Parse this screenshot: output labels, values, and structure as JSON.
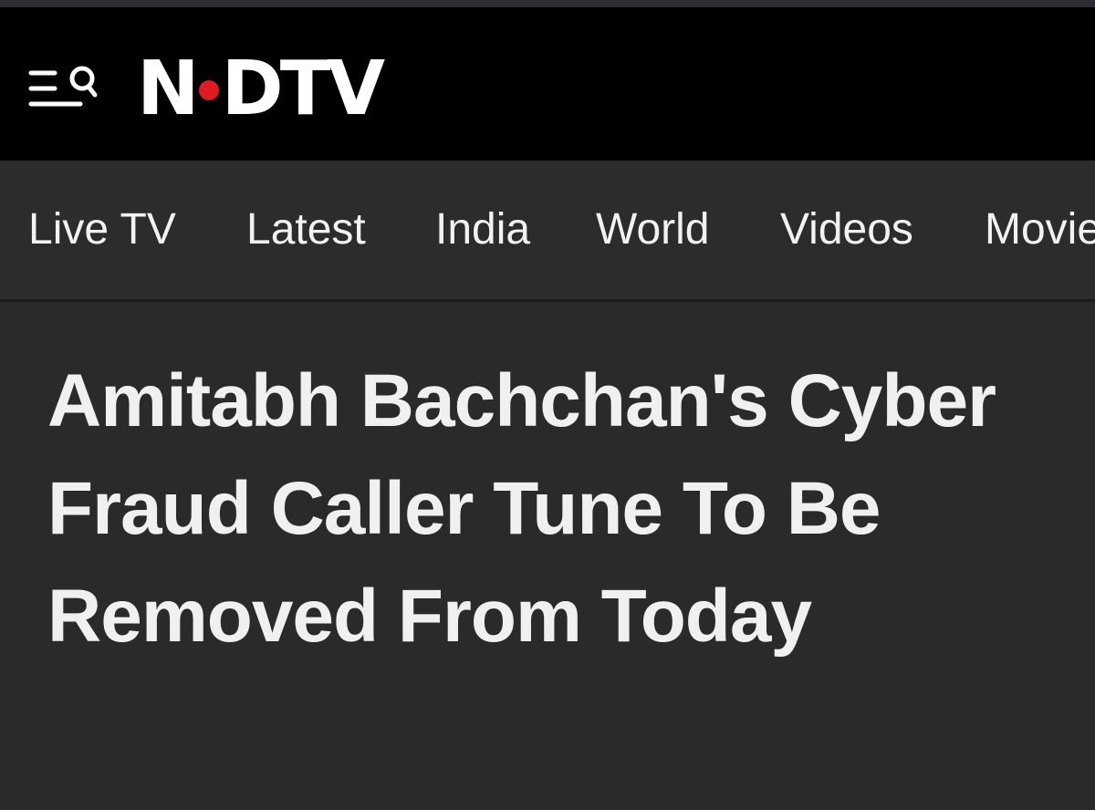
{
  "header": {
    "menu_icon": "hamburger-search-icon",
    "logo_text_left": "N",
    "logo_text_right": "DTV",
    "logo_dot_color": "#e01b22"
  },
  "nav": {
    "items": [
      {
        "label": "Live TV"
      },
      {
        "label": "Latest"
      },
      {
        "label": "India"
      },
      {
        "label": "World"
      },
      {
        "label": "Videos"
      },
      {
        "label": "Movie"
      }
    ]
  },
  "article": {
    "headline": "Amitabh Bachchan's Cyber Fraud Caller Tune To Be Removed From Today"
  }
}
